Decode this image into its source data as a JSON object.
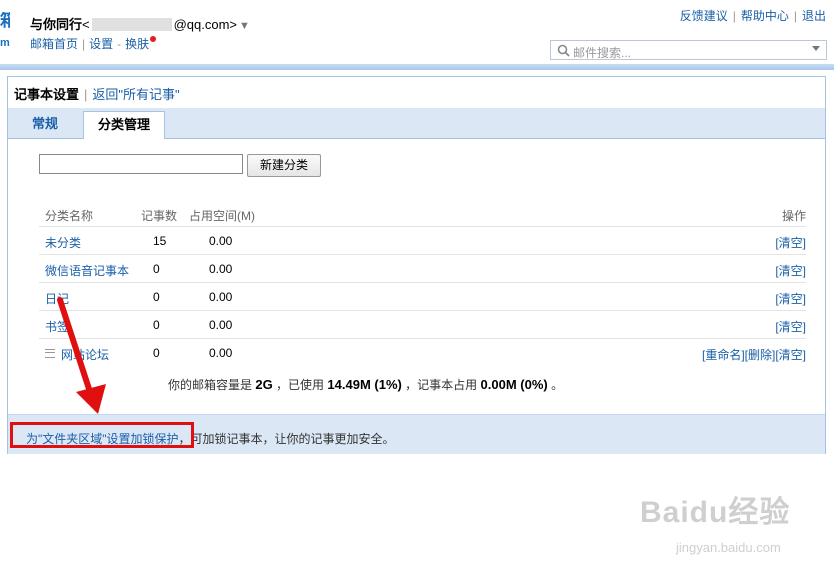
{
  "header": {
    "logo_fragment": "箱",
    "logo_fragment2": "m",
    "user_name": "与你同行",
    "email_prefix": "<",
    "email_suffix": "@qq.com>",
    "dropdown_glyph": "▼",
    "nav": {
      "home": "邮箱首页",
      "settings": "设置",
      "skin": "换肤"
    },
    "toplinks": {
      "feedback": "反馈建议",
      "help": "帮助中心",
      "logout": "退出"
    },
    "search_placeholder": "邮件搜索..."
  },
  "page": {
    "title": "记事本设置",
    "back_link": "返回\"所有记事\""
  },
  "tabs": [
    {
      "label": "常规",
      "active": false
    },
    {
      "label": "分类管理",
      "active": true
    }
  ],
  "new_category": {
    "value": "",
    "button_label": "新建分类"
  },
  "table": {
    "headers": {
      "name": "分类名称",
      "count": "记事数",
      "size": "占用空间(M)",
      "ops": "操作"
    },
    "rows": [
      {
        "name": "未分类",
        "count": "15",
        "size": "0.00",
        "ops": "[清空]",
        "draggable": false
      },
      {
        "name": "微信语音记事本",
        "count": "0",
        "size": "0.00",
        "ops": "[清空]",
        "draggable": false
      },
      {
        "name": "日记",
        "count": "0",
        "size": "0.00",
        "ops": "[清空]",
        "draggable": false
      },
      {
        "name": "书签",
        "count": "0",
        "size": "0.00",
        "ops": "[清空]",
        "draggable": false
      },
      {
        "name": "网站论坛",
        "count": "0",
        "size": "0.00",
        "ops": "[重命名][删除][清空]",
        "draggable": true
      }
    ]
  },
  "quota": {
    "prefix": "你的邮箱容量是",
    "capacity": "2G",
    "used_label": "，已使用",
    "used": "14.49M (1%)",
    "notes_label": "，记事本占用",
    "notes": "0.00M (0%)",
    "end": "。"
  },
  "footer": {
    "link": "为\"文件夹区域\"设置加锁保护",
    "text": "，可加锁记事本，让你的记事更加安全。"
  },
  "annotation_color": "#e01010",
  "watermark": {
    "main": "Baidu经验",
    "sub": "jingyan.baidu.com"
  }
}
